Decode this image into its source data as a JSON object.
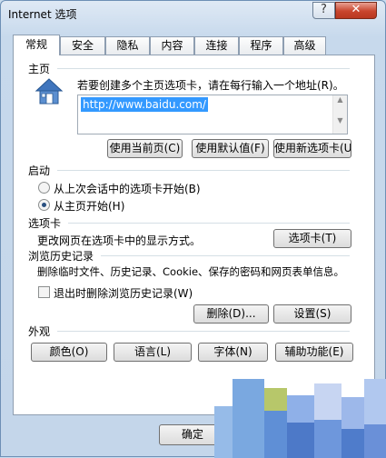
{
  "window": {
    "title": "Internet 选项",
    "help_label": "?",
    "close_label": "✕"
  },
  "tabs": [
    {
      "label": "常规"
    },
    {
      "label": "安全"
    },
    {
      "label": "隐私"
    },
    {
      "label": "内容"
    },
    {
      "label": "连接"
    },
    {
      "label": "程序"
    },
    {
      "label": "高级"
    }
  ],
  "homepage": {
    "heading": "主页",
    "instruction": "若要创建多个主页选项卡，请在每行输入一个地址(R)。",
    "url": "http://www.baidu.com/",
    "icon": "house-icon",
    "buttons": {
      "use_current": "使用当前页(C)",
      "use_default": "使用默认值(F)",
      "use_new_tab": "使用新选项卡(U)"
    }
  },
  "startup": {
    "heading": "启动",
    "options": [
      {
        "label": "从上次会话中的选项卡开始(B)",
        "selected": false
      },
      {
        "label": "从主页开始(H)",
        "selected": true
      }
    ]
  },
  "tabs_section": {
    "heading": "选项卡",
    "description": "更改网页在选项卡中的显示方式。",
    "button": "选项卡(T)"
  },
  "history": {
    "heading": "浏览历史记录",
    "description": "删除临时文件、历史记录、Cookie、保存的密码和网页表单信息。",
    "checkbox_label": "退出时删除浏览历史记录(W)",
    "checkbox_checked": false,
    "delete_button": "删除(D)...",
    "settings_button": "设置(S)"
  },
  "appearance": {
    "heading": "外观",
    "buttons": {
      "colors": "颜色(O)",
      "languages": "语言(L)",
      "fonts": "字体(N)",
      "accessibility": "辅助功能(E)"
    }
  },
  "footer": {
    "ok_button": "确定"
  }
}
